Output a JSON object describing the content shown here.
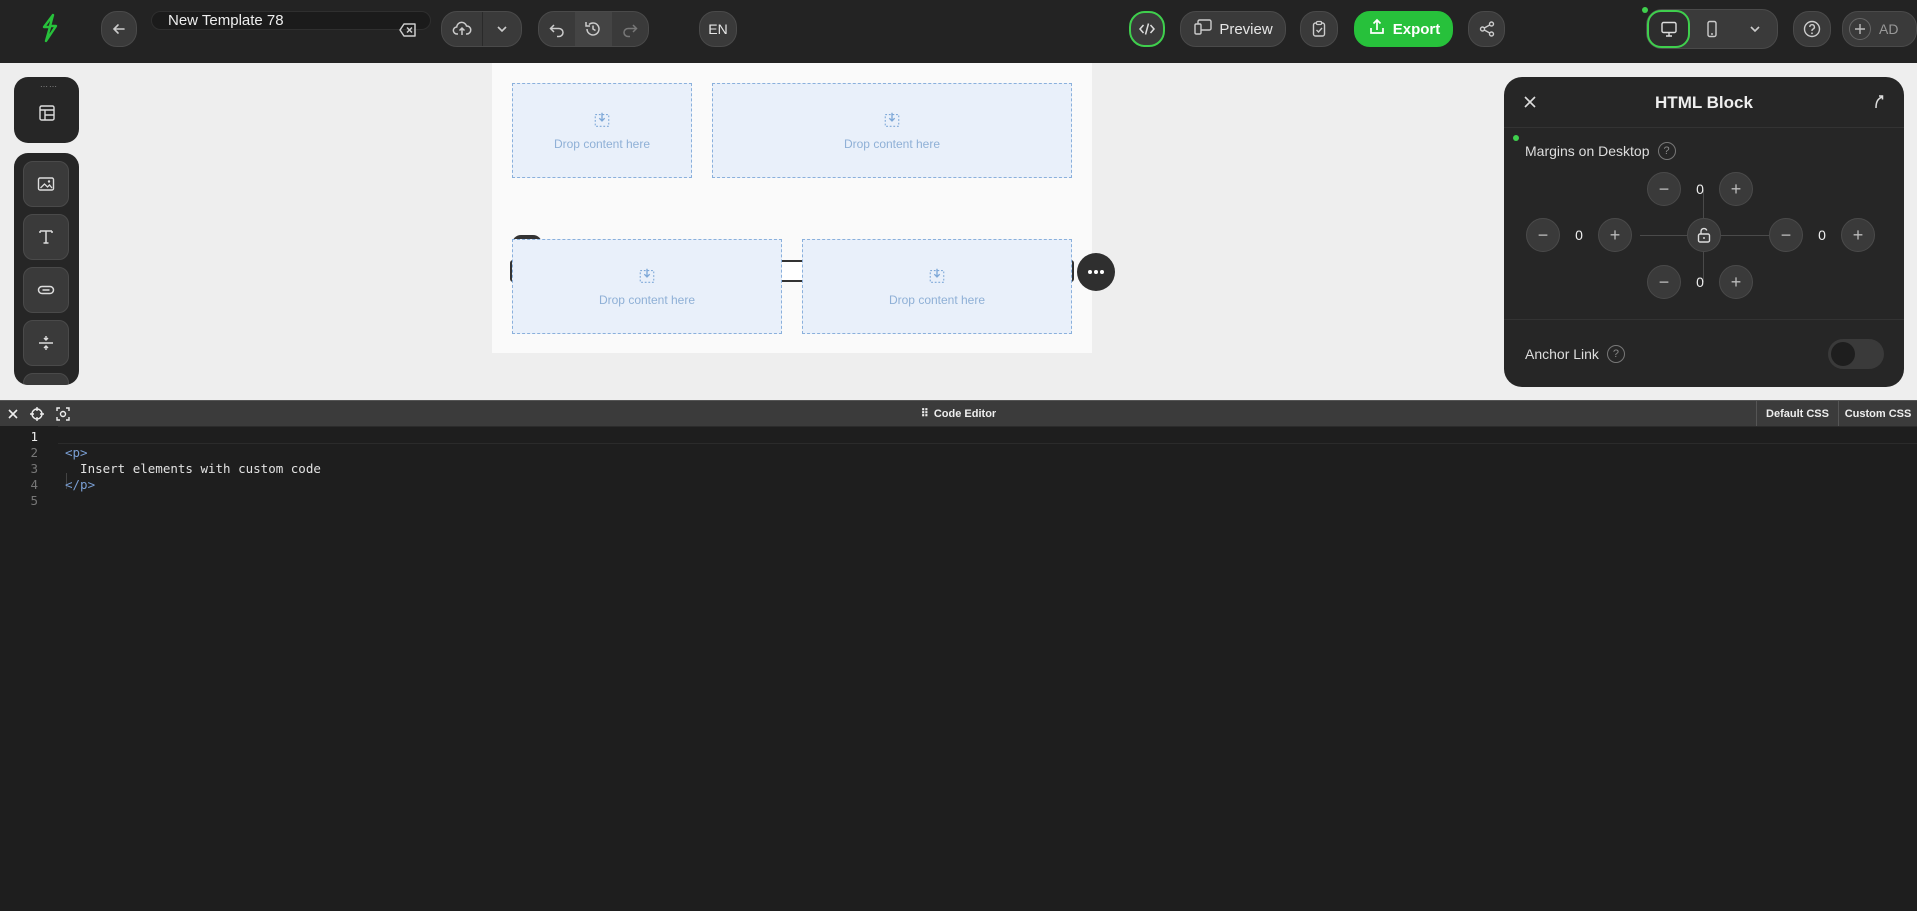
{
  "header": {
    "template_name": "New Template 78",
    "language": "EN",
    "preview_label": "Preview",
    "export_label": "Export",
    "user_initials": "AD"
  },
  "canvas": {
    "drop_label": "Drop content here",
    "html_block_text": "Insert elements with custom code"
  },
  "panel": {
    "title": "HTML Block",
    "margins_label": "Margins on Desktop",
    "margin_top": "0",
    "margin_left": "0",
    "margin_right": "0",
    "margin_bottom": "0",
    "anchor_label": "Anchor Link",
    "anchor_enabled": false
  },
  "editor": {
    "title": "Code Editor",
    "tabs": [
      "Default CSS",
      "Custom CSS"
    ],
    "line_numbers": [
      "1",
      "2",
      "3",
      "4",
      "5"
    ],
    "lines": [
      "",
      "<p>",
      "  Insert elements with custom code",
      "</p>",
      ""
    ]
  },
  "colors": {
    "accent": "#27c13b",
    "drop_bg": "#e9f0fa",
    "drop_border": "#8ab0dc",
    "code_tag": "#7a9fd4"
  }
}
